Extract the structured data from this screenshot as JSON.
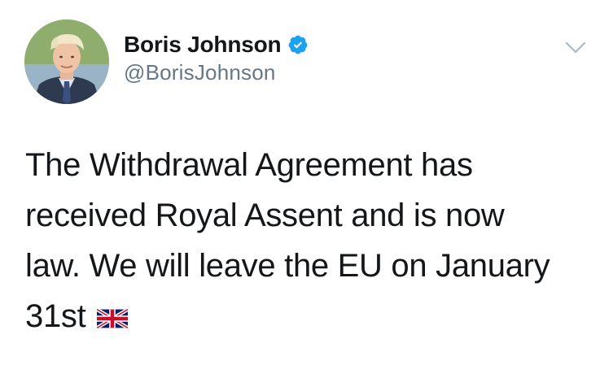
{
  "tweet": {
    "author": {
      "display_name": "Boris Johnson",
      "handle": "@BorisJohnson",
      "verified_icon": "verified-badge-icon",
      "avatar_icon": "profile-photo"
    },
    "text": "The Withdrawal Agreement has\nreceived Royal Assent and is now\nlaw. We will leave the EU on January\n31st",
    "emoji": "uk-flag-icon",
    "menu_icon": "chevron-down-icon"
  },
  "colors": {
    "text": "#14171a",
    "secondary": "#657786",
    "verified": "#1da1f2",
    "caret": "#aab8c2"
  }
}
